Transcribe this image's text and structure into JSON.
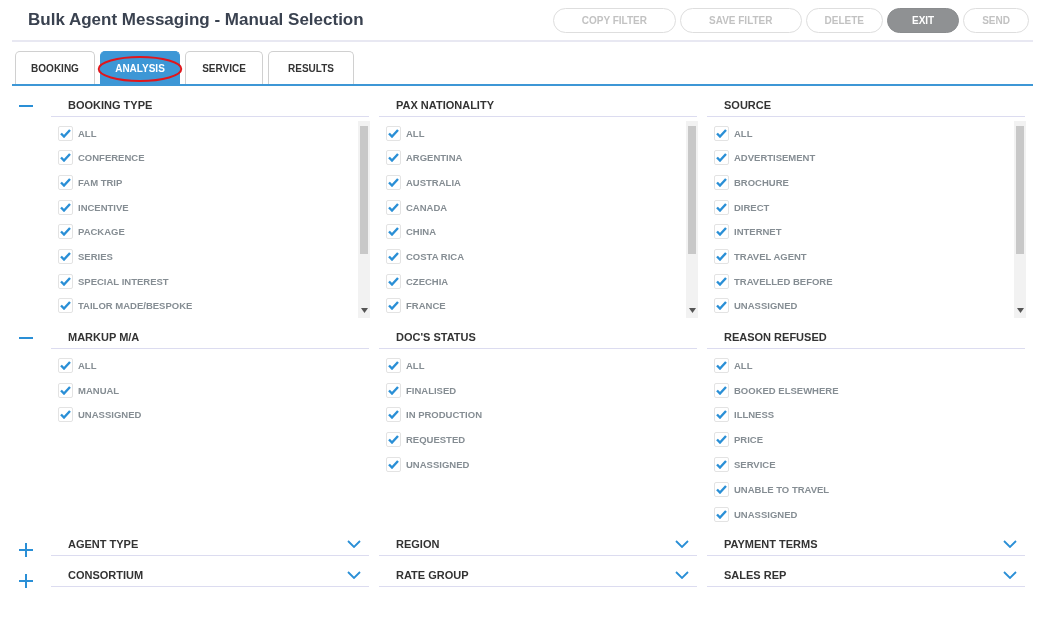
{
  "title": "Bulk Agent Messaging - Manual Selection",
  "actions": [
    {
      "label": "COPY FILTER",
      "disabled": true
    },
    {
      "label": "SAVE FILTER",
      "disabled": true
    },
    {
      "label": "DELETE",
      "disabled": true
    },
    {
      "label": "EXIT",
      "disabled": false
    },
    {
      "label": "SEND",
      "disabled": true
    }
  ],
  "tabs": [
    {
      "label": "BOOKING",
      "selected": false,
      "circled": false
    },
    {
      "label": "ANALYSIS",
      "selected": true,
      "circled": true
    },
    {
      "label": "SERVICE",
      "selected": false,
      "circled": false
    },
    {
      "label": "RESULTS",
      "selected": false,
      "circled": false
    }
  ],
  "groups": [
    {
      "expanded": true,
      "panels": [
        {
          "title": "BOOKING TYPE",
          "kind": "scroll",
          "items": [
            {
              "label": "ALL",
              "checked": true
            },
            {
              "label": "CONFERENCE",
              "checked": true
            },
            {
              "label": "FAM TRIP",
              "checked": true
            },
            {
              "label": "INCENTIVE",
              "checked": true
            },
            {
              "label": "PACKAGE",
              "checked": true
            },
            {
              "label": "SERIES",
              "checked": true
            },
            {
              "label": "SPECIAL INTEREST",
              "checked": true
            },
            {
              "label": "TAILOR MADE/BESPOKE",
              "checked": true
            }
          ]
        },
        {
          "title": "PAX NATIONALITY",
          "kind": "scroll",
          "items": [
            {
              "label": "ALL",
              "checked": true
            },
            {
              "label": "ARGENTINA",
              "checked": true
            },
            {
              "label": "AUSTRALIA",
              "checked": true
            },
            {
              "label": "CANADA",
              "checked": true
            },
            {
              "label": "CHINA",
              "checked": true
            },
            {
              "label": "COSTA RICA",
              "checked": true
            },
            {
              "label": "CZECHIA",
              "checked": true
            },
            {
              "label": "FRANCE",
              "checked": true
            }
          ]
        },
        {
          "title": "SOURCE",
          "kind": "scroll",
          "items": [
            {
              "label": "ALL",
              "checked": true
            },
            {
              "label": "ADVERTISEMENT",
              "checked": true
            },
            {
              "label": "BROCHURE",
              "checked": true
            },
            {
              "label": "DIRECT",
              "checked": true
            },
            {
              "label": "INTERNET",
              "checked": true
            },
            {
              "label": "TRAVEL AGENT",
              "checked": true
            },
            {
              "label": "TRAVELLED BEFORE",
              "checked": true
            },
            {
              "label": "UNASSIGNED",
              "checked": true
            }
          ]
        }
      ]
    },
    {
      "expanded": true,
      "panels": [
        {
          "title": "MARKUP M/A",
          "kind": "list",
          "items": [
            {
              "label": "ALL",
              "checked": true
            },
            {
              "label": "MANUAL",
              "checked": true
            },
            {
              "label": "UNASSIGNED",
              "checked": true
            }
          ]
        },
        {
          "title": "DOC'S STATUS",
          "kind": "list",
          "items": [
            {
              "label": "ALL",
              "checked": true
            },
            {
              "label": "FINALISED",
              "checked": true
            },
            {
              "label": "IN PRODUCTION",
              "checked": true
            },
            {
              "label": "REQUESTED",
              "checked": true
            },
            {
              "label": "UNASSIGNED",
              "checked": true
            }
          ]
        },
        {
          "title": "REASON REFUSED",
          "kind": "list",
          "items": [
            {
              "label": "ALL",
              "checked": true
            },
            {
              "label": "BOOKED ELSEWHERE",
              "checked": true
            },
            {
              "label": "ILLNESS",
              "checked": true
            },
            {
              "label": "PRICE",
              "checked": true
            },
            {
              "label": "SERVICE",
              "checked": true
            },
            {
              "label": "UNABLE TO TRAVEL",
              "checked": true
            },
            {
              "label": "UNASSIGNED",
              "checked": true
            }
          ]
        }
      ]
    },
    {
      "expanded": false,
      "panels": [
        {
          "title": "AGENT TYPE"
        },
        {
          "title": "REGION"
        },
        {
          "title": "PAYMENT TERMS"
        }
      ]
    },
    {
      "expanded": false,
      "panels": [
        {
          "title": "CONSORTIUM"
        },
        {
          "title": "RATE GROUP"
        },
        {
          "title": "SALES REP"
        }
      ]
    }
  ]
}
